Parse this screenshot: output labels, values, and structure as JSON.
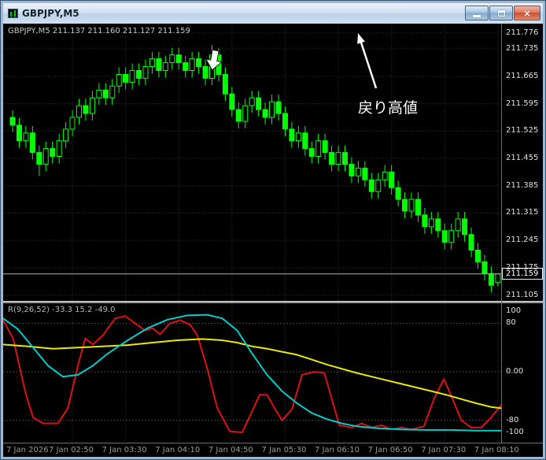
{
  "window": {
    "title": "GBPJPY,M5",
    "controls": {
      "close_glyph": "×"
    }
  },
  "chart": {
    "ohlc_line": "GBPJPY,M5  211.137 211.160 211.127 211.159",
    "indicator_line": "R(9,26,52) -33.3 15.2 -49.0",
    "current_price_label": "211.159",
    "annotation_text": "戻り高値"
  },
  "chart_data": [
    {
      "type": "candlestick",
      "symbol": "GBPJPY",
      "timeframe": "M5",
      "title": "GBPJPY,M5",
      "ylim": [
        211.09,
        211.8
      ],
      "current_price": 211.159,
      "y_axis_labels": [
        "211.776",
        "211.735",
        "211.665",
        "211.595",
        "211.525",
        "211.455",
        "211.385",
        "211.315",
        "211.245",
        "211.175",
        "211.105"
      ],
      "x_axis_labels": [
        "7 Jan 2026",
        "7 Jan 02:50",
        "7 Jan 03:30",
        "7 Jan 04:10",
        "7 Jan 04:50",
        "7 Jan 05:30",
        "7 Jan 06:10",
        "7 Jan 06:50",
        "7 Jan 07:30",
        "7 Jan 08:10"
      ],
      "x_label_indices": [
        9,
        17,
        25,
        33,
        41,
        49,
        57,
        65,
        73
      ],
      "colors": {
        "up": "#00ff00",
        "background": "#000000",
        "grid": "#2b2b2b",
        "bid_line": "#b0b0b0"
      },
      "candles": [
        [
          211.56,
          211.578,
          211.522,
          211.54
        ],
        [
          211.54,
          211.558,
          211.482,
          211.5
        ],
        [
          211.5,
          211.538,
          211.482,
          211.52
        ],
        [
          211.52,
          211.538,
          211.452,
          211.47
        ],
        [
          211.47,
          211.488,
          211.41,
          211.44
        ],
        [
          211.44,
          211.498,
          211.422,
          211.48
        ],
        [
          211.48,
          211.498,
          211.442,
          211.46
        ],
        [
          211.46,
          211.518,
          211.442,
          211.5
        ],
        [
          211.5,
          211.548,
          211.482,
          211.53
        ],
        [
          211.53,
          211.578,
          211.512,
          211.56
        ],
        [
          211.56,
          211.608,
          211.542,
          211.59
        ],
        [
          211.59,
          211.608,
          211.552,
          211.57
        ],
        [
          211.57,
          211.628,
          211.552,
          211.61
        ],
        [
          211.61,
          211.648,
          211.592,
          211.63
        ],
        [
          211.63,
          211.648,
          211.592,
          211.61
        ],
        [
          211.61,
          211.658,
          211.592,
          211.64
        ],
        [
          211.64,
          211.688,
          211.622,
          211.67
        ],
        [
          211.67,
          211.688,
          211.632,
          211.65
        ],
        [
          211.65,
          211.698,
          211.632,
          211.68
        ],
        [
          211.68,
          211.698,
          211.642,
          211.66
        ],
        [
          211.66,
          211.708,
          211.642,
          211.69
        ],
        [
          211.69,
          211.728,
          211.672,
          211.71
        ],
        [
          211.71,
          211.728,
          211.662,
          211.68
        ],
        [
          211.68,
          211.718,
          211.662,
          211.7
        ],
        [
          211.7,
          211.738,
          211.682,
          211.72
        ],
        [
          211.72,
          211.738,
          211.682,
          211.7
        ],
        [
          211.7,
          211.718,
          211.662,
          211.68
        ],
        [
          211.68,
          211.728,
          211.662,
          211.71
        ],
        [
          211.71,
          211.728,
          211.672,
          211.69
        ],
        [
          211.69,
          211.708,
          211.642,
          211.66
        ],
        [
          211.66,
          211.745,
          211.642,
          211.72
        ],
        [
          211.72,
          211.738,
          211.652,
          211.67
        ],
        [
          211.67,
          211.688,
          211.602,
          211.62
        ],
        [
          211.62,
          211.638,
          211.562,
          211.58
        ],
        [
          211.58,
          211.598,
          211.532,
          211.55
        ],
        [
          211.55,
          211.608,
          211.532,
          211.59
        ],
        [
          211.59,
          211.628,
          211.572,
          211.61
        ],
        [
          211.61,
          211.628,
          211.562,
          211.58
        ],
        [
          211.58,
          211.598,
          211.542,
          211.56
        ],
        [
          211.56,
          211.618,
          211.542,
          211.6
        ],
        [
          211.6,
          211.618,
          211.552,
          211.57
        ],
        [
          211.57,
          211.588,
          211.512,
          211.53
        ],
        [
          211.53,
          211.548,
          211.482,
          211.5
        ],
        [
          211.5,
          211.538,
          211.482,
          211.52
        ],
        [
          211.52,
          211.538,
          211.462,
          211.48
        ],
        [
          211.48,
          211.498,
          211.442,
          211.46
        ],
        [
          211.46,
          211.518,
          211.442,
          211.5
        ],
        [
          211.5,
          211.518,
          211.452,
          211.47
        ],
        [
          211.47,
          211.488,
          211.422,
          211.44
        ],
        [
          211.44,
          211.488,
          211.422,
          211.47
        ],
        [
          211.47,
          211.488,
          211.422,
          211.44
        ],
        [
          211.44,
          211.458,
          211.392,
          211.41
        ],
        [
          211.41,
          211.448,
          211.392,
          211.43
        ],
        [
          211.43,
          211.448,
          211.382,
          211.4
        ],
        [
          211.4,
          211.418,
          211.352,
          211.37
        ],
        [
          211.37,
          211.418,
          211.352,
          211.4
        ],
        [
          211.4,
          211.438,
          211.382,
          211.42
        ],
        [
          211.42,
          211.438,
          211.362,
          211.38
        ],
        [
          211.38,
          211.398,
          211.332,
          211.35
        ],
        [
          211.35,
          211.368,
          211.302,
          211.32
        ],
        [
          211.32,
          211.368,
          211.302,
          211.35
        ],
        [
          211.35,
          211.368,
          211.292,
          211.31
        ],
        [
          211.31,
          211.328,
          211.262,
          211.28
        ],
        [
          211.28,
          211.318,
          211.262,
          211.3
        ],
        [
          211.3,
          211.318,
          211.252,
          211.27
        ],
        [
          211.27,
          211.288,
          211.222,
          211.24
        ],
        [
          211.24,
          211.288,
          211.222,
          211.27
        ],
        [
          211.27,
          211.318,
          211.252,
          211.3
        ],
        [
          211.3,
          211.318,
          211.242,
          211.26
        ],
        [
          211.26,
          211.278,
          211.202,
          211.22
        ],
        [
          211.22,
          211.238,
          211.172,
          211.19
        ],
        [
          211.19,
          211.208,
          211.142,
          211.16
        ],
        [
          211.16,
          211.178,
          211.112,
          211.13
        ],
        [
          211.137,
          211.16,
          211.127,
          211.159
        ]
      ]
    },
    {
      "type": "line",
      "name": "R(9,26,52)",
      "values_label": "-33.3 15.2 -49.0",
      "ylim": [
        -110,
        110
      ],
      "y_axis_labels": [
        "100",
        "80",
        "0.00",
        "-80",
        "-100"
      ],
      "levels": [
        80,
        0,
        -80
      ],
      "series": [
        {
          "name": "red",
          "color": "#dd1111",
          "points": [
            [
              0.0,
              85
            ],
            [
              0.02,
              55
            ],
            [
              0.045,
              -35
            ],
            [
              0.06,
              -75
            ],
            [
              0.08,
              -85
            ],
            [
              0.11,
              -85
            ],
            [
              0.13,
              -60
            ],
            [
              0.15,
              10
            ],
            [
              0.165,
              55
            ],
            [
              0.18,
              45
            ],
            [
              0.2,
              60
            ],
            [
              0.225,
              88
            ],
            [
              0.245,
              92
            ],
            [
              0.265,
              80
            ],
            [
              0.285,
              68
            ],
            [
              0.3,
              72
            ],
            [
              0.315,
              62
            ],
            [
              0.335,
              80
            ],
            [
              0.355,
              85
            ],
            [
              0.375,
              78
            ],
            [
              0.39,
              60
            ],
            [
              0.41,
              5
            ],
            [
              0.43,
              -60
            ],
            [
              0.455,
              -98
            ],
            [
              0.48,
              -100
            ],
            [
              0.5,
              -65
            ],
            [
              0.515,
              -38
            ],
            [
              0.53,
              -38
            ],
            [
              0.545,
              -60
            ],
            [
              0.56,
              -80
            ],
            [
              0.58,
              -62
            ],
            [
              0.6,
              -5
            ],
            [
              0.625,
              0
            ],
            [
              0.645,
              -2
            ],
            [
              0.66,
              -45
            ],
            [
              0.675,
              -88
            ],
            [
              0.7,
              -92
            ],
            [
              0.72,
              -85
            ],
            [
              0.74,
              -92
            ],
            [
              0.76,
              -88
            ],
            [
              0.78,
              -95
            ],
            [
              0.8,
              -92
            ],
            [
              0.82,
              -95
            ],
            [
              0.845,
              -90
            ],
            [
              0.865,
              -45
            ],
            [
              0.885,
              -12
            ],
            [
              0.9,
              -40
            ],
            [
              0.92,
              -80
            ],
            [
              0.94,
              -92
            ],
            [
              0.96,
              -92
            ],
            [
              0.98,
              -75
            ],
            [
              1.0,
              -55
            ]
          ]
        },
        {
          "name": "yellow",
          "color": "#eaea00",
          "points": [
            [
              0.0,
              45
            ],
            [
              0.05,
              42
            ],
            [
              0.1,
              38
            ],
            [
              0.15,
              40
            ],
            [
              0.2,
              42
            ],
            [
              0.25,
              44
            ],
            [
              0.3,
              48
            ],
            [
              0.35,
              52
            ],
            [
              0.4,
              54
            ],
            [
              0.44,
              52
            ],
            [
              0.47,
              48
            ],
            [
              0.5,
              42
            ],
            [
              0.53,
              38
            ],
            [
              0.56,
              33
            ],
            [
              0.59,
              28
            ],
            [
              0.62,
              20
            ],
            [
              0.65,
              12
            ],
            [
              0.68,
              5
            ],
            [
              0.71,
              -2
            ],
            [
              0.74,
              -8
            ],
            [
              0.77,
              -14
            ],
            [
              0.8,
              -20
            ],
            [
              0.83,
              -26
            ],
            [
              0.86,
              -32
            ],
            [
              0.89,
              -38
            ],
            [
              0.92,
              -45
            ],
            [
              0.95,
              -52
            ],
            [
              0.98,
              -58
            ],
            [
              1.0,
              -60
            ]
          ]
        },
        {
          "name": "cyan",
          "color": "#00cccc",
          "points": [
            [
              0.0,
              88
            ],
            [
              0.03,
              70
            ],
            [
              0.06,
              40
            ],
            [
              0.09,
              10
            ],
            [
              0.12,
              -8
            ],
            [
              0.15,
              -5
            ],
            [
              0.18,
              10
            ],
            [
              0.21,
              30
            ],
            [
              0.25,
              52
            ],
            [
              0.29,
              72
            ],
            [
              0.33,
              86
            ],
            [
              0.37,
              93
            ],
            [
              0.41,
              94
            ],
            [
              0.44,
              88
            ],
            [
              0.47,
              68
            ],
            [
              0.5,
              30
            ],
            [
              0.53,
              -5
            ],
            [
              0.56,
              -32
            ],
            [
              0.59,
              -52
            ],
            [
              0.62,
              -68
            ],
            [
              0.65,
              -78
            ],
            [
              0.68,
              -85
            ],
            [
              0.71,
              -90
            ],
            [
              0.75,
              -93
            ],
            [
              0.8,
              -95
            ],
            [
              0.85,
              -96
            ],
            [
              0.9,
              -96
            ],
            [
              0.95,
              -97
            ],
            [
              1.0,
              -97
            ]
          ]
        }
      ]
    }
  ]
}
